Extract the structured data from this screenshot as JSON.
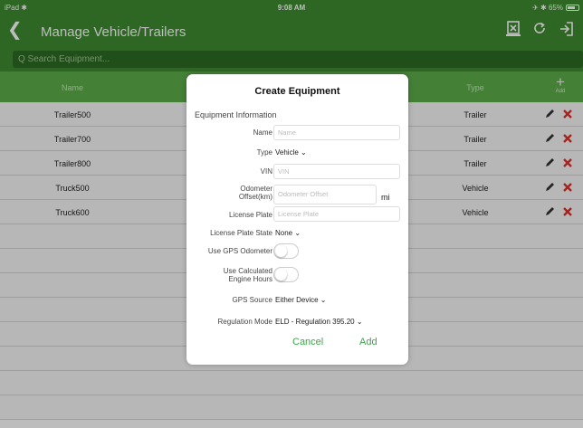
{
  "status_bar": {
    "left": "iPad ✱",
    "time": "9:08 AM",
    "right": "✈ ✱ 65%"
  },
  "nav": {
    "back_glyph": "❮",
    "title": "Manage Vehicle/Trailers",
    "icons": [
      "export-icon",
      "refresh-icon",
      "logout-icon"
    ]
  },
  "search": {
    "placeholder": "Q Search Equipment..."
  },
  "table": {
    "headers": {
      "name": "Name",
      "type": "Type",
      "add": "Add"
    },
    "rows": [
      {
        "name": "Trailer500",
        "type": "Trailer"
      },
      {
        "name": "Trailer700",
        "type": "Trailer"
      },
      {
        "name": "Trailer800",
        "type": "Trailer"
      },
      {
        "name": "Truck500",
        "type": "Vehicle"
      },
      {
        "name": "Truck600",
        "type": "Vehicle"
      }
    ]
  },
  "modal": {
    "title": "Create Equipment",
    "section": "Equipment Information",
    "name_label": "Name",
    "name_placeholder": "Name",
    "type_label": "Type",
    "type_value": "Vehicle ⌄",
    "vin_label": "VIN",
    "vin_placeholder": "VIN",
    "odometer_label": "Odometer\nOffset(km)",
    "odometer_placeholder": "Odometer Offset",
    "odometer_unit": "mi",
    "plate_label": "License Plate",
    "plate_placeholder": "License Plate",
    "plate_state_label": "License Plate State",
    "plate_state_value": "None ⌄",
    "gps_odometer_label": "Use GPS Odometer",
    "calc_hours_label": "Use Calculated\nEngine Hours",
    "gps_source_label": "GPS Source",
    "gps_source_value": "Either Device ⌄",
    "regulation_label": "Regulation Mode",
    "regulation_value": "ELD - Regulation 395.20 ⌄",
    "cancel": "Cancel",
    "add": "Add"
  },
  "colors": {
    "header_green": "#3f8a30",
    "table_header_green": "#5cae4b",
    "accent_green": "#3aa64a",
    "delete_red": "#e0302a"
  }
}
